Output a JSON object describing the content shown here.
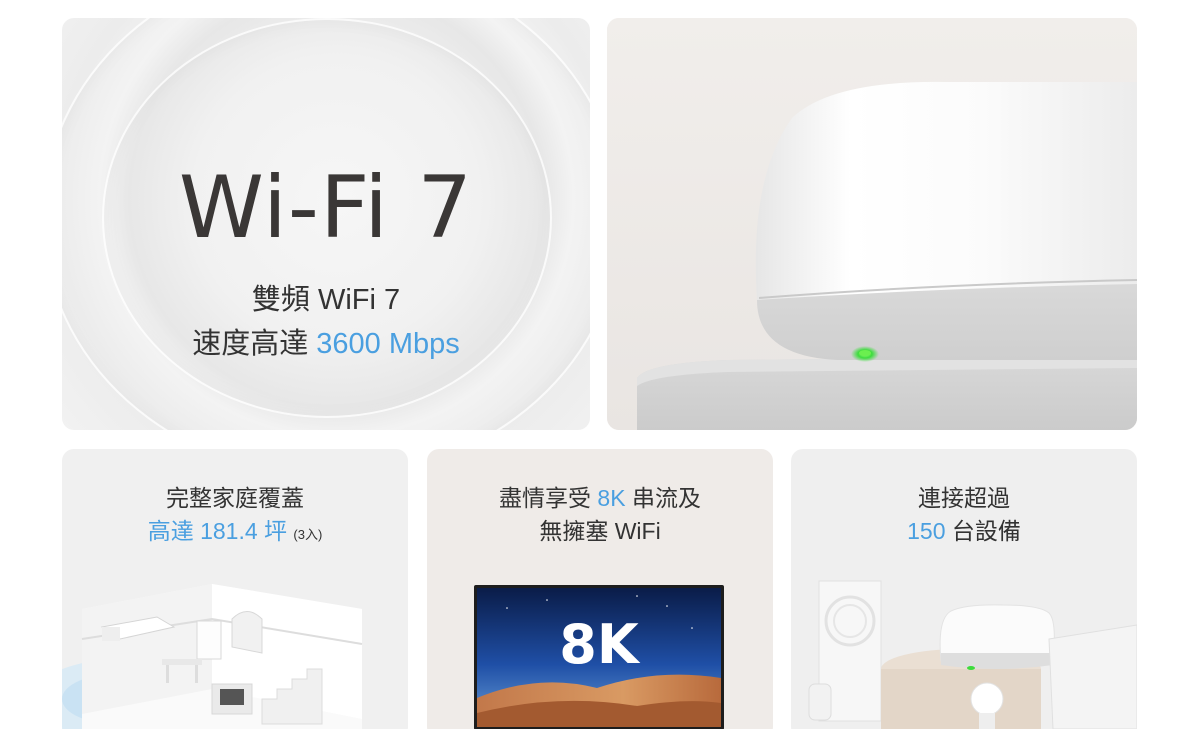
{
  "hero": {
    "title": "Wi-Fi 7",
    "line1": "雙頻 WiFi 7",
    "line2_prefix": "速度高達 ",
    "line2_highlight": "3600 Mbps"
  },
  "coverage": {
    "line1": "完整家庭覆蓋",
    "line2_highlight": "高達 181.4 坪",
    "line2_note": "(3入)"
  },
  "streaming": {
    "line1_prefix": "盡情享受 ",
    "line1_highlight": "8K",
    "line1_suffix": " 串流及",
    "line2": "無擁塞 WiFi",
    "tv_label": "8K"
  },
  "devices": {
    "line1": "連接超過",
    "line2_highlight": "150",
    "line2_suffix": " 台設備"
  },
  "colors": {
    "accent_blue": "#4a9fe0",
    "status_led_green": "#3ddc3d"
  }
}
